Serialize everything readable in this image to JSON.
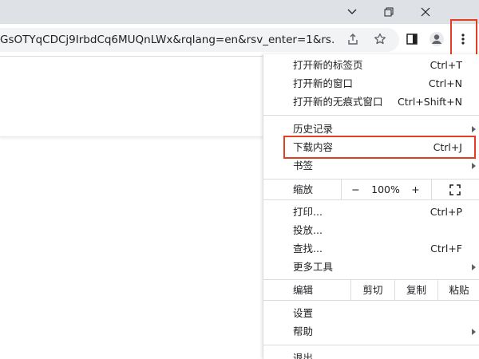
{
  "window": {
    "minimize_icon": "chevron-down-icon",
    "controls": [
      "minimize-icon",
      "restore-icon",
      "close-icon"
    ]
  },
  "toolbar": {
    "url": "GsOTYqCDCj9IrbdCq6MUQnLWx&rqlang=en&rsv_enter=1&rs...",
    "icons": [
      "share-icon",
      "bookmark-star-icon",
      "side-panel-icon",
      "profile-icon",
      "more-vert-icon"
    ]
  },
  "menu": {
    "new_tab": {
      "label": "打开新的标签页",
      "shortcut": "Ctrl+T"
    },
    "new_window": {
      "label": "打开新的窗口",
      "shortcut": "Ctrl+N"
    },
    "incognito": {
      "label": "打开新的无痕式窗口",
      "shortcut": "Ctrl+Shift+N"
    },
    "history": {
      "label": "历史记录"
    },
    "downloads": {
      "label": "下载内容",
      "shortcut": "Ctrl+J"
    },
    "bookmarks": {
      "label": "书签"
    },
    "zoom": {
      "label": "缩放",
      "minus": "−",
      "value": "100%",
      "plus": "+"
    },
    "print": {
      "label": "打印...",
      "shortcut": "Ctrl+P"
    },
    "cast": {
      "label": "投放..."
    },
    "find": {
      "label": "查找...",
      "shortcut": "Ctrl+F"
    },
    "more_tools": {
      "label": "更多工具"
    },
    "edit": {
      "label": "编辑",
      "cut": "剪切",
      "copy": "复制",
      "paste": "粘贴"
    },
    "settings": {
      "label": "设置"
    },
    "help": {
      "label": "帮助"
    },
    "exit": {
      "label": "退出"
    }
  },
  "colors": {
    "highlight": "#e0401f",
    "titlebar": "#dee1e6",
    "omnibox": "#f1f3f4"
  }
}
